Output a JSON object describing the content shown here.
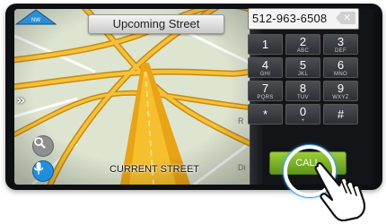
{
  "map": {
    "upcoming_street": "Upcoming Street",
    "current_street": "CURRENT STREET",
    "compass_heading": "NW",
    "expand_arrow": "»"
  },
  "dialer": {
    "phone_number": "512-963-6508",
    "keys": [
      {
        "digit": "1",
        "letters": ""
      },
      {
        "digit": "2",
        "letters": "ABC"
      },
      {
        "digit": "3",
        "letters": "DEF"
      },
      {
        "digit": "4",
        "letters": "GHI"
      },
      {
        "digit": "5",
        "letters": "JKL"
      },
      {
        "digit": "6",
        "letters": "MNO"
      },
      {
        "digit": "7",
        "letters": "PQRS"
      },
      {
        "digit": "8",
        "letters": "TUV"
      },
      {
        "digit": "9",
        "letters": "WXYZ"
      },
      {
        "digit": "*",
        "letters": ""
      },
      {
        "digit": "0",
        "letters": "+"
      },
      {
        "digit": "#",
        "letters": ""
      }
    ],
    "call_label": "CALL",
    "background_letters": [
      "R",
      "Di"
    ]
  },
  "colors": {
    "call_green": "#7bb52a",
    "highlight_blue": "#3aa0e8",
    "mic_blue": "#1f8ee0",
    "road_yellow": "#f2b61c"
  },
  "icons": {
    "search": "search-icon",
    "mic": "microphone-icon",
    "backspace": "backspace-icon",
    "hand": "pointing-hand-icon"
  }
}
